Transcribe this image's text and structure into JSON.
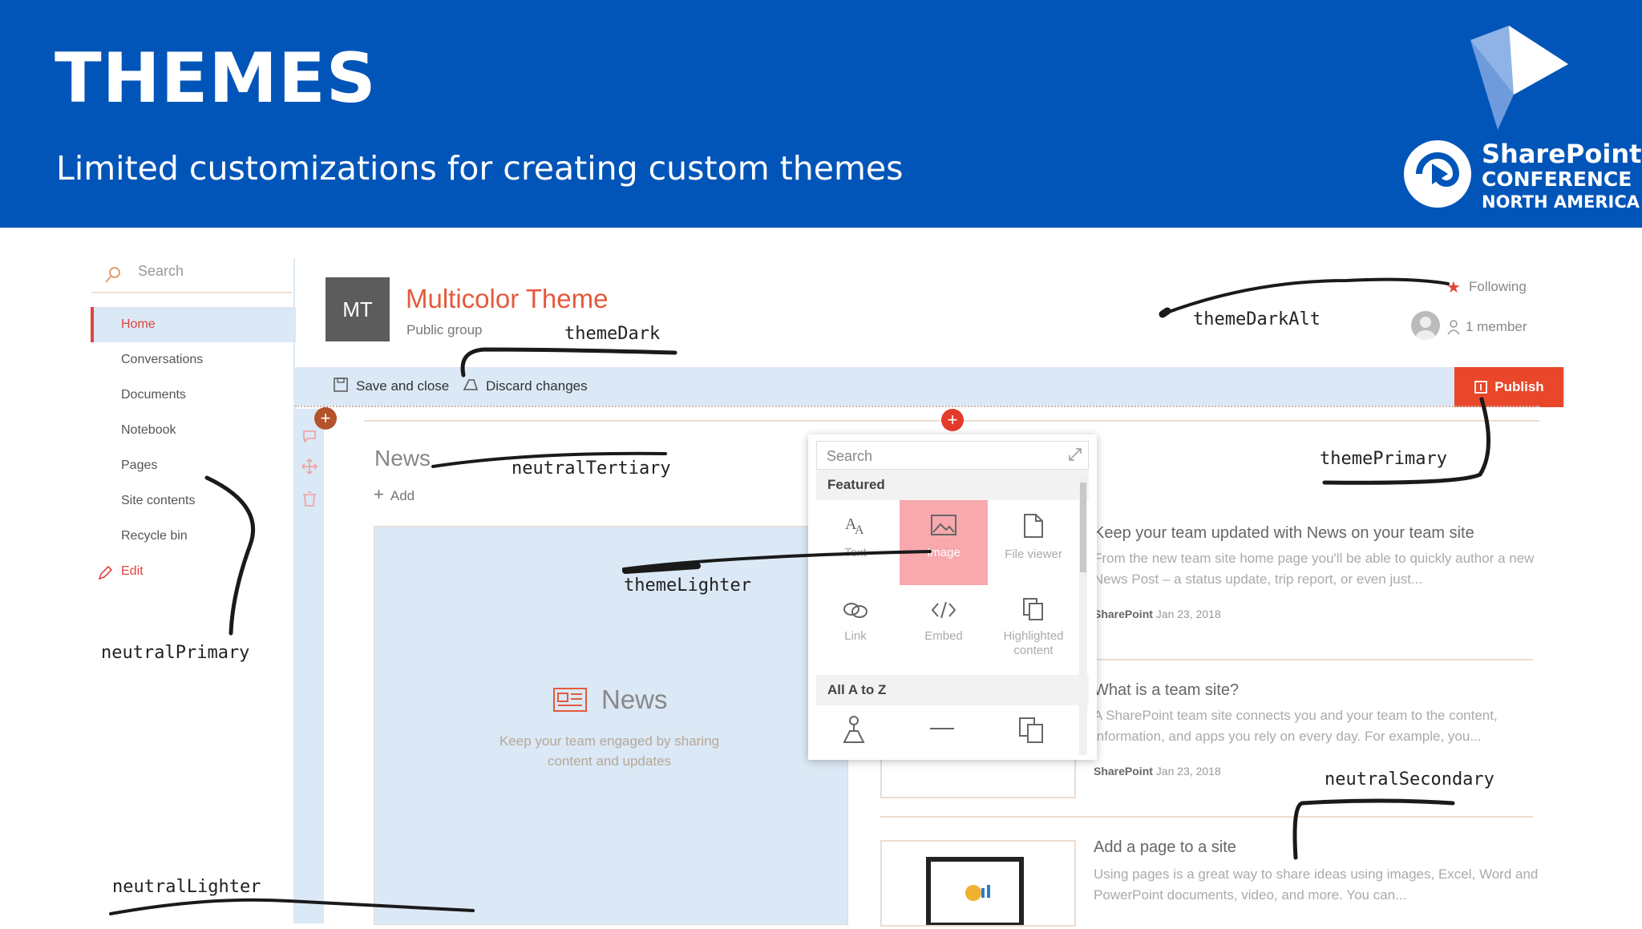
{
  "slide": {
    "title": "THEMES",
    "subtitle": "Limited customizations for creating custom themes",
    "logo": {
      "line1": "SharePoint",
      "line2": "CONFERENCE",
      "line3": "NORTH AMERICA"
    }
  },
  "colors": {
    "banner": "#0255b8",
    "accent": "#e45a3c",
    "publish": "#e8472a",
    "light": "#dbe8f5",
    "selected": "#f7a9ad"
  },
  "leftnav": {
    "search_placeholder": "Search",
    "items": [
      "Home",
      "Conversations",
      "Documents",
      "Notebook",
      "Pages",
      "Site contents",
      "Recycle bin"
    ],
    "edit": "Edit"
  },
  "site": {
    "logo_initials": "MT",
    "title": "Multicolor Theme",
    "subtitle": "Public group",
    "following": "Following",
    "members": "1 member"
  },
  "commandbar": {
    "save": "Save and close",
    "discard": "Discard changes",
    "publish": "Publish"
  },
  "news_webpart": {
    "heading": "News",
    "add": "Add",
    "placeholder_title": "News",
    "placeholder_desc": "Keep your team engaged by sharing content and updates"
  },
  "toolbox": {
    "search_placeholder": "Search",
    "featured_label": "Featured",
    "featured": [
      {
        "label": "Text",
        "icon": "text-icon"
      },
      {
        "label": "Image",
        "icon": "image-icon"
      },
      {
        "label": "File viewer",
        "icon": "file-icon"
      },
      {
        "label": "Link",
        "icon": "link-icon"
      },
      {
        "label": "Embed",
        "icon": "embed-icon"
      },
      {
        "label": "Highlighted content",
        "icon": "highlighted-content-icon"
      }
    ],
    "all_label": "All A to Z"
  },
  "news_items": [
    {
      "title": "Keep your team updated with News on your team site",
      "desc": "From the new team site home page you'll be able to quickly author a new News Post – a status update, trip report, or even just...",
      "author": "SharePoint",
      "date": "Jan 23, 2018"
    },
    {
      "title": "What is a team site?",
      "desc": "A SharePoint team site connects you and your team to the content, information, and apps you rely on every day. For example, you...",
      "author": "SharePoint",
      "date": "Jan 23, 2018"
    },
    {
      "title": "Add a page to a site",
      "desc": "Using pages is a great way to share ideas using images, Excel, Word and PowerPoint documents, video, and more. You can..."
    }
  ],
  "annotations": {
    "themeDark": "themeDark",
    "themeDarkAlt": "themeDarkAlt",
    "themePrimary": "themePrimary",
    "neutralTertiary": "neutralTertiary",
    "themeLighter": "themeLighter",
    "neutralPrimary": "neutralPrimary",
    "neutralSecondary": "neutralSecondary",
    "neutralLighter": "neutralLighter"
  }
}
